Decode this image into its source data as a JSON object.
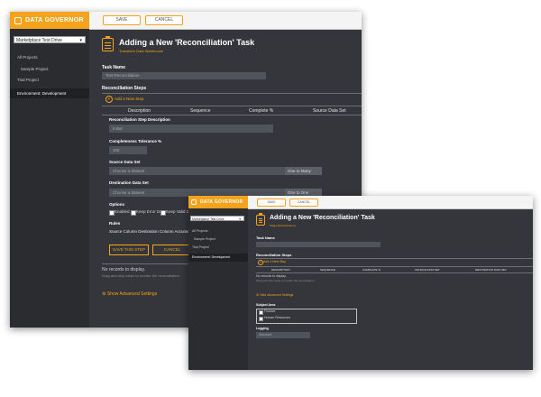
{
  "app": {
    "name": "DATA GOVERNOR"
  },
  "toolbar": {
    "save_label": "SAVE",
    "cancel_label": "CANCEL"
  },
  "sidebar": {
    "project_select": "Marketplace Test Drive",
    "items": [
      {
        "label": "All Projects"
      },
      {
        "label": "Sample Project"
      },
      {
        "label": "Trial Project"
      },
      {
        "label": "Environment: Development"
      }
    ]
  },
  "main": {
    "title": "Adding a New 'Reconciliation' Task",
    "subtitle": "Transform Data Warehouse",
    "task_name_label": "Task Name",
    "task_name_value": "Test Reconciliation",
    "steps_label": "Reconciliation Steps",
    "add_step": "Add a New Step",
    "columns": [
      "Description",
      "Sequence",
      "Complete %",
      "Source Data Set"
    ],
    "step_desc_label": "Reconciliation Step Description",
    "step_desc_value": "Initial",
    "tolerance_label": "Completeness Tolerance %",
    "tolerance_value": "100",
    "source_label": "Source Data Set",
    "source_placeholder": "Choose a dataset",
    "source_relation": "One to Many",
    "dest_label": "Destination Data Set",
    "dest_placeholder": "Choose a dataset",
    "dest_relation": "One to One",
    "options_label": "Options",
    "options": [
      "Enabled",
      "Keep Error Data",
      "Keep Valid D"
    ],
    "rules_label": "Rules",
    "rules_text": "Source Column Destination Column Accuracy",
    "save_step": "SAVE THIS STEP",
    "cancel_step": "CANCEL",
    "no_records": "No records to display.",
    "drag_hint": "Drag and drop steps to reorder the reconciliation.",
    "advanced": "Show Advanced Settings"
  },
  "win2": {
    "subtitle": "Stage Administrations",
    "task_name_label": "Task Name",
    "steps_label": "Reconciliation Steps",
    "add_step": "Add a New Step",
    "columns": [
      "DESCRIPTION",
      "SEQUENCE",
      "COMPLETE %",
      "SOURCE DATA SET",
      "DESTINATION DATA SET"
    ],
    "no_records": "No records to display.",
    "drag_hint": "Drag and drop steps to reorder the reconciliation.",
    "advanced": "Hide Advanced Settings",
    "subject_label": "Subject Area",
    "subjects": [
      "Finance",
      "Human Resources"
    ],
    "logging_label": "Logging",
    "logging_value": "Standard"
  }
}
